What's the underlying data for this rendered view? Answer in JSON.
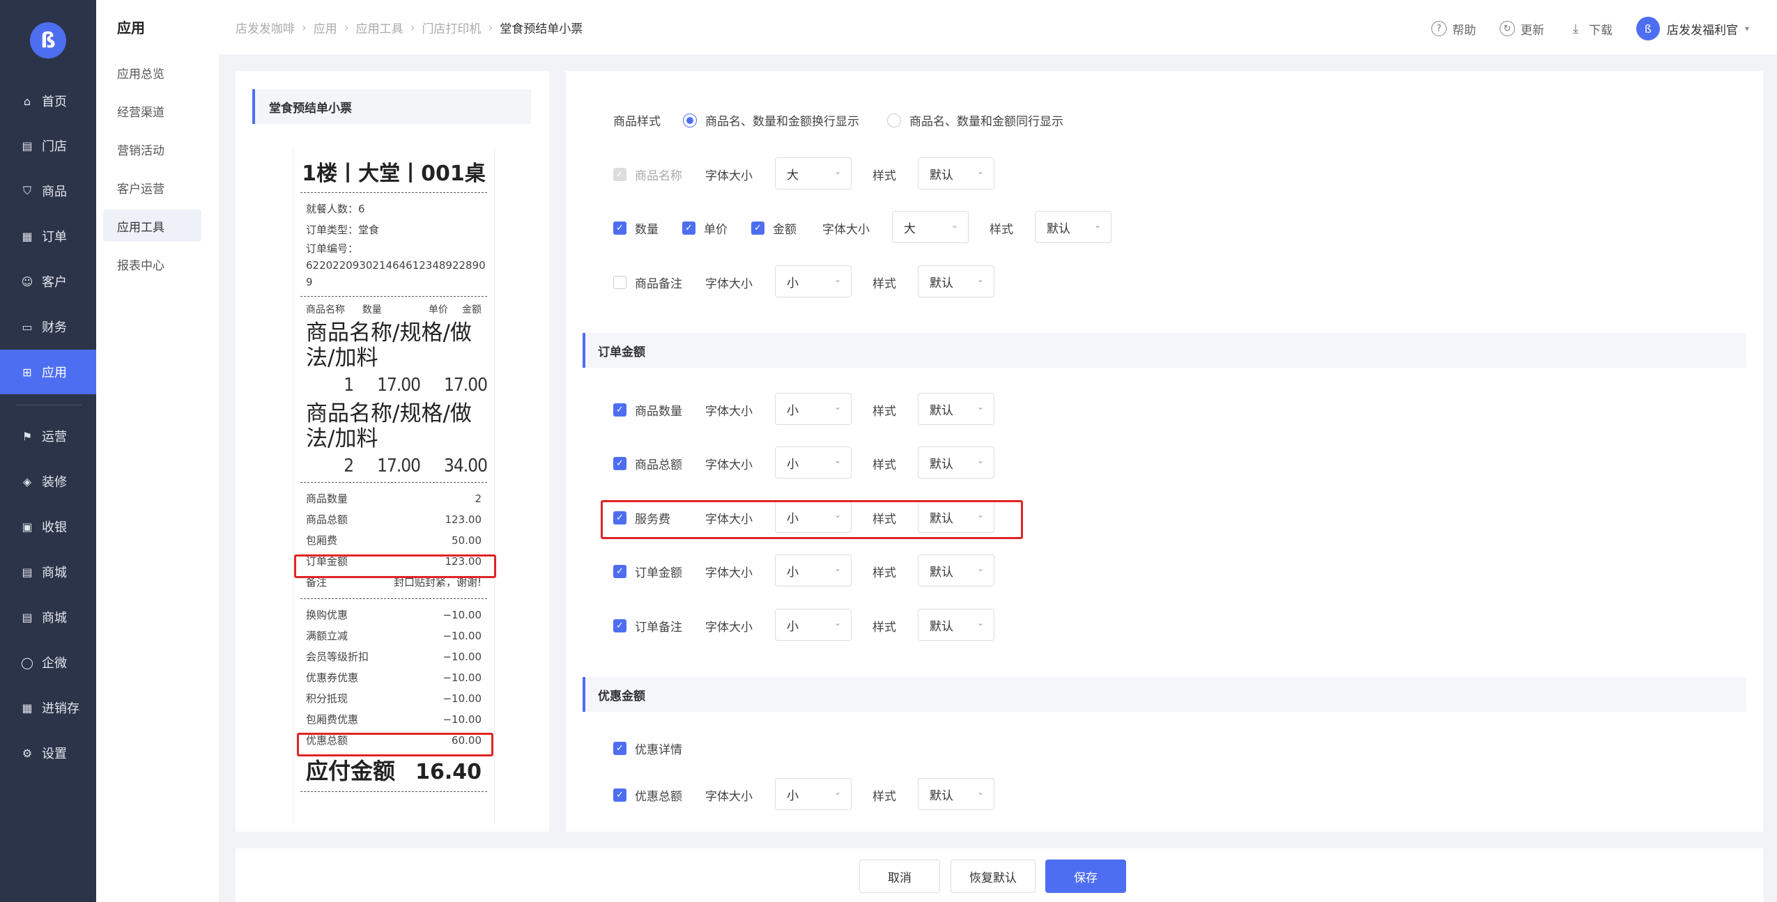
{
  "nav": {
    "logo": "ß",
    "items": [
      {
        "label": "首页",
        "icon": "⌂"
      },
      {
        "label": "门店",
        "icon": "▤"
      },
      {
        "label": "商品",
        "icon": "⛉"
      },
      {
        "label": "订单",
        "icon": "▦"
      },
      {
        "label": "客户",
        "icon": "☺"
      },
      {
        "label": "财务",
        "icon": "▭"
      },
      {
        "label": "应用",
        "icon": "⊞"
      },
      {
        "label": "运营",
        "icon": "⚑"
      },
      {
        "label": "装修",
        "icon": "◈"
      },
      {
        "label": "收银",
        "icon": "▣"
      },
      {
        "label": "商城",
        "icon": "▤"
      },
      {
        "label": "商城",
        "icon": "▤"
      },
      {
        "label": "企微",
        "icon": "◯"
      },
      {
        "label": "进销存",
        "icon": "▦"
      },
      {
        "label": "设置",
        "icon": "⚙"
      }
    ]
  },
  "subnav": {
    "title": "应用",
    "items": [
      "应用总览",
      "经营渠道",
      "营销活动",
      "客户运营",
      "应用工具",
      "报表中心"
    ]
  },
  "breadcrumb": [
    "店发发咖啡",
    "应用",
    "应用工具",
    "门店打印机",
    "堂食预结单小票"
  ],
  "top": {
    "help": "帮助",
    "update": "更新",
    "download": "下载",
    "user": "店发发福利官"
  },
  "preview": {
    "title": "堂食预结单小票",
    "receipt": {
      "table": "1楼丨大堂丨001桌",
      "diners": "就餐人数：6",
      "order_type": "订单类型：堂食",
      "order_no_label": "订单编号：",
      "order_no": "622022093021464612348922890",
      "order_no_tail": "9",
      "cols": [
        "商品名称",
        "数量",
        "单价",
        "金额"
      ],
      "items": [
        {
          "name1": "商品名称/规格/做",
          "name2": "法/加料",
          "qty": "1",
          "price": "17.00",
          "amount": "17.00"
        },
        {
          "name1": "商品名称/规格/做",
          "name2": "法/加料",
          "qty": "2",
          "price": "17.00",
          "amount": "34.00"
        }
      ],
      "summary": [
        {
          "label": "商品数量",
          "value": "2"
        },
        {
          "label": "商品总额",
          "value": "123.00"
        },
        {
          "label": "包厢费",
          "value": "50.00"
        },
        {
          "label": "订单金额",
          "value": "123.00"
        },
        {
          "label": "备注",
          "value": "封口贴封紧，谢谢!"
        }
      ],
      "discounts": [
        {
          "label": "换购优惠",
          "value": "−10.00"
        },
        {
          "label": "满额立减",
          "value": "−10.00"
        },
        {
          "label": "会员等级折扣",
          "value": "−10.00"
        },
        {
          "label": "优惠券优惠",
          "value": "−10.00"
        },
        {
          "label": "积分抵现",
          "value": "−10.00"
        },
        {
          "label": "包厢费优惠",
          "value": "−10.00"
        },
        {
          "label": "优惠总额",
          "value": "60.00"
        }
      ],
      "total_label": "应付金额",
      "total_value": "16.40"
    }
  },
  "settings": {
    "goods_style_label": "商品样式",
    "goods_style_opt1": "商品名、数量和金额换行显示",
    "goods_style_opt2": "商品名、数量和金额同行显示",
    "font_size_label": "字体大小",
    "style_label": "样式",
    "default": "默认",
    "big": "大",
    "small": "小",
    "goods_name": "商品名称",
    "qty": "数量",
    "unit_price": "单价",
    "amount": "金额",
    "goods_remark": "商品备注",
    "section_order": "订单金额",
    "order_rows": [
      "商品数量",
      "商品总额",
      "服务费",
      "订单金额",
      "订单备注"
    ],
    "section_discount": "优惠金额",
    "discount_detail": "优惠详情",
    "discount_total": "优惠总额"
  },
  "footer": {
    "cancel": "取消",
    "restore": "恢复默认",
    "save": "保存"
  },
  "colors": {
    "accent": "#4e6ef2",
    "nav_bg": "#2c3449",
    "highlight": "#e02424"
  }
}
